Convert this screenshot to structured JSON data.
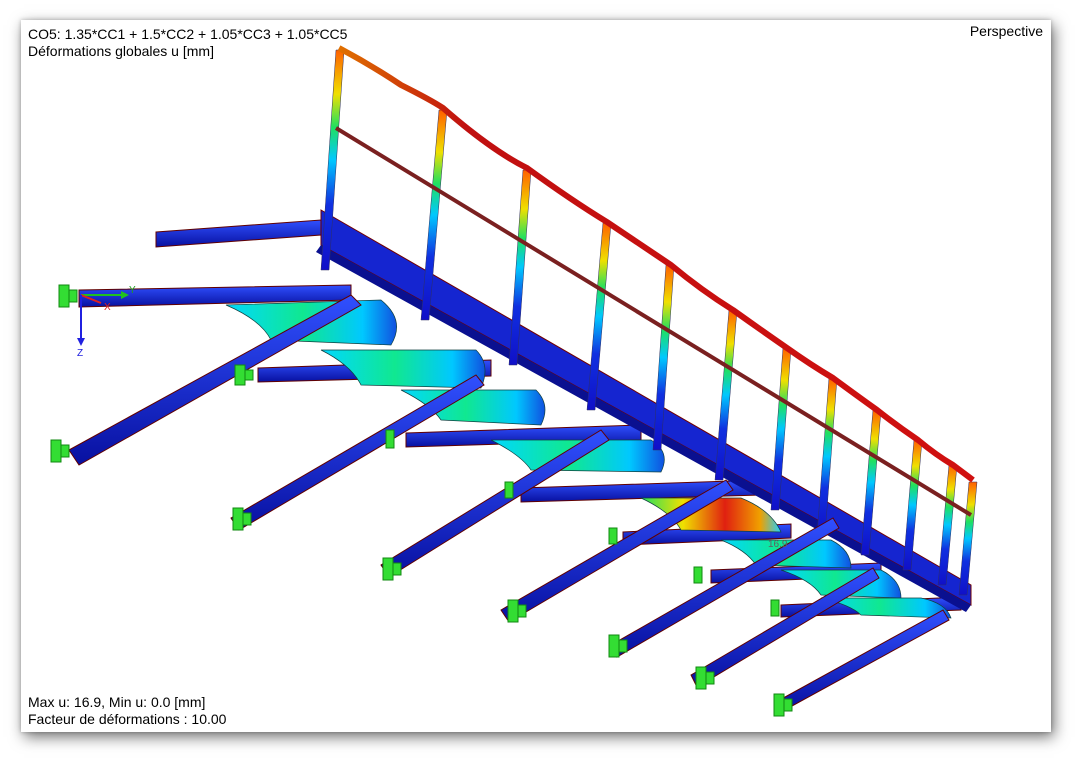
{
  "header": {
    "combination": "CO5: 1.35*CC1 + 1.5*CC2 + 1.05*CC3 + 1.05*CC5",
    "result_type": "Déformations globales u [mm]",
    "view_mode": "Perspective"
  },
  "footer": {
    "max_min": "Max u: 16.9, Min u: 0.0 [mm]",
    "deformation_factor": "Facteur de déformations : 10.00"
  },
  "model": {
    "max_label": "16.9",
    "axes": {
      "x": "X",
      "y": "Y",
      "z": "Z"
    }
  },
  "colors": {
    "low": "#1010c8",
    "mid_low": "#00c8ff",
    "mid": "#20e060",
    "mid_high": "#f0e000",
    "high": "#d01010",
    "support": "#33dd33",
    "edge": "#8b0000"
  }
}
